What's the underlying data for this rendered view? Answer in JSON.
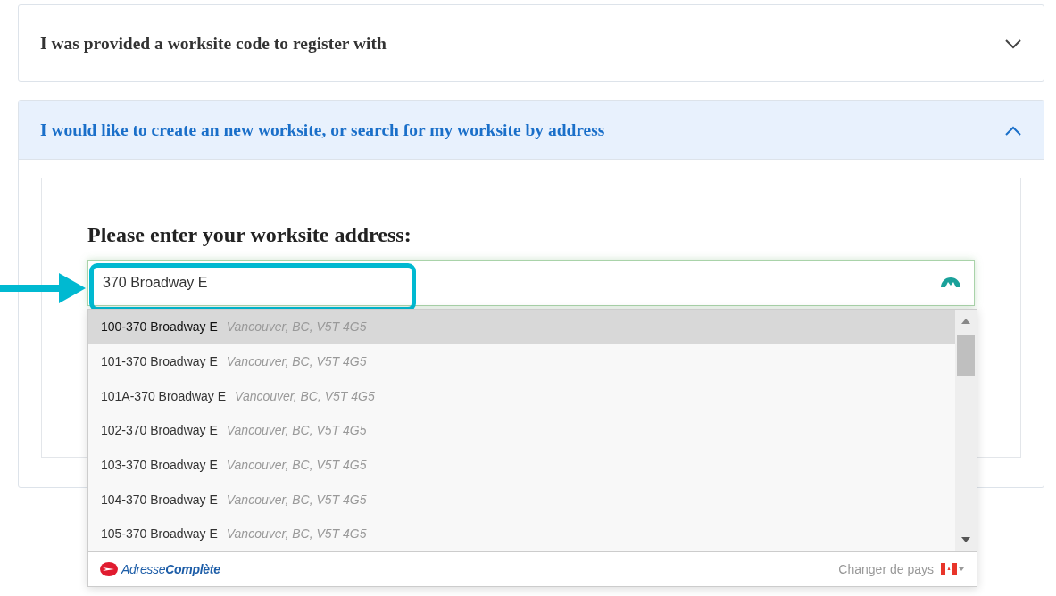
{
  "accordion": [
    {
      "title": "I was provided a worksite code to register with",
      "expanded": false
    },
    {
      "title": "I would like to create an new worksite, or search for my worksite by address",
      "expanded": true
    }
  ],
  "form": {
    "label": "Please enter your worksite address:",
    "value": "370 Broadway E"
  },
  "suggestions": [
    {
      "street": "100-370 Broadway E",
      "city": "Vancouver, BC, V5T 4G5",
      "selected": true
    },
    {
      "street": "101-370 Broadway E",
      "city": "Vancouver, BC, V5T 4G5",
      "selected": false
    },
    {
      "street": "101A-370 Broadway E",
      "city": "Vancouver, BC, V5T 4G5",
      "selected": false
    },
    {
      "street": "102-370 Broadway E",
      "city": "Vancouver, BC, V5T 4G5",
      "selected": false
    },
    {
      "street": "103-370 Broadway E",
      "city": "Vancouver, BC, V5T 4G5",
      "selected": false
    },
    {
      "street": "104-370 Broadway E",
      "city": "Vancouver, BC, V5T 4G5",
      "selected": false
    },
    {
      "street": "105-370 Broadway E",
      "city": "Vancouver, BC, V5T 4G5",
      "selected": false
    }
  ],
  "footer": {
    "brand": "Adresse**Complète**",
    "country_link": "Changer de pays"
  }
}
